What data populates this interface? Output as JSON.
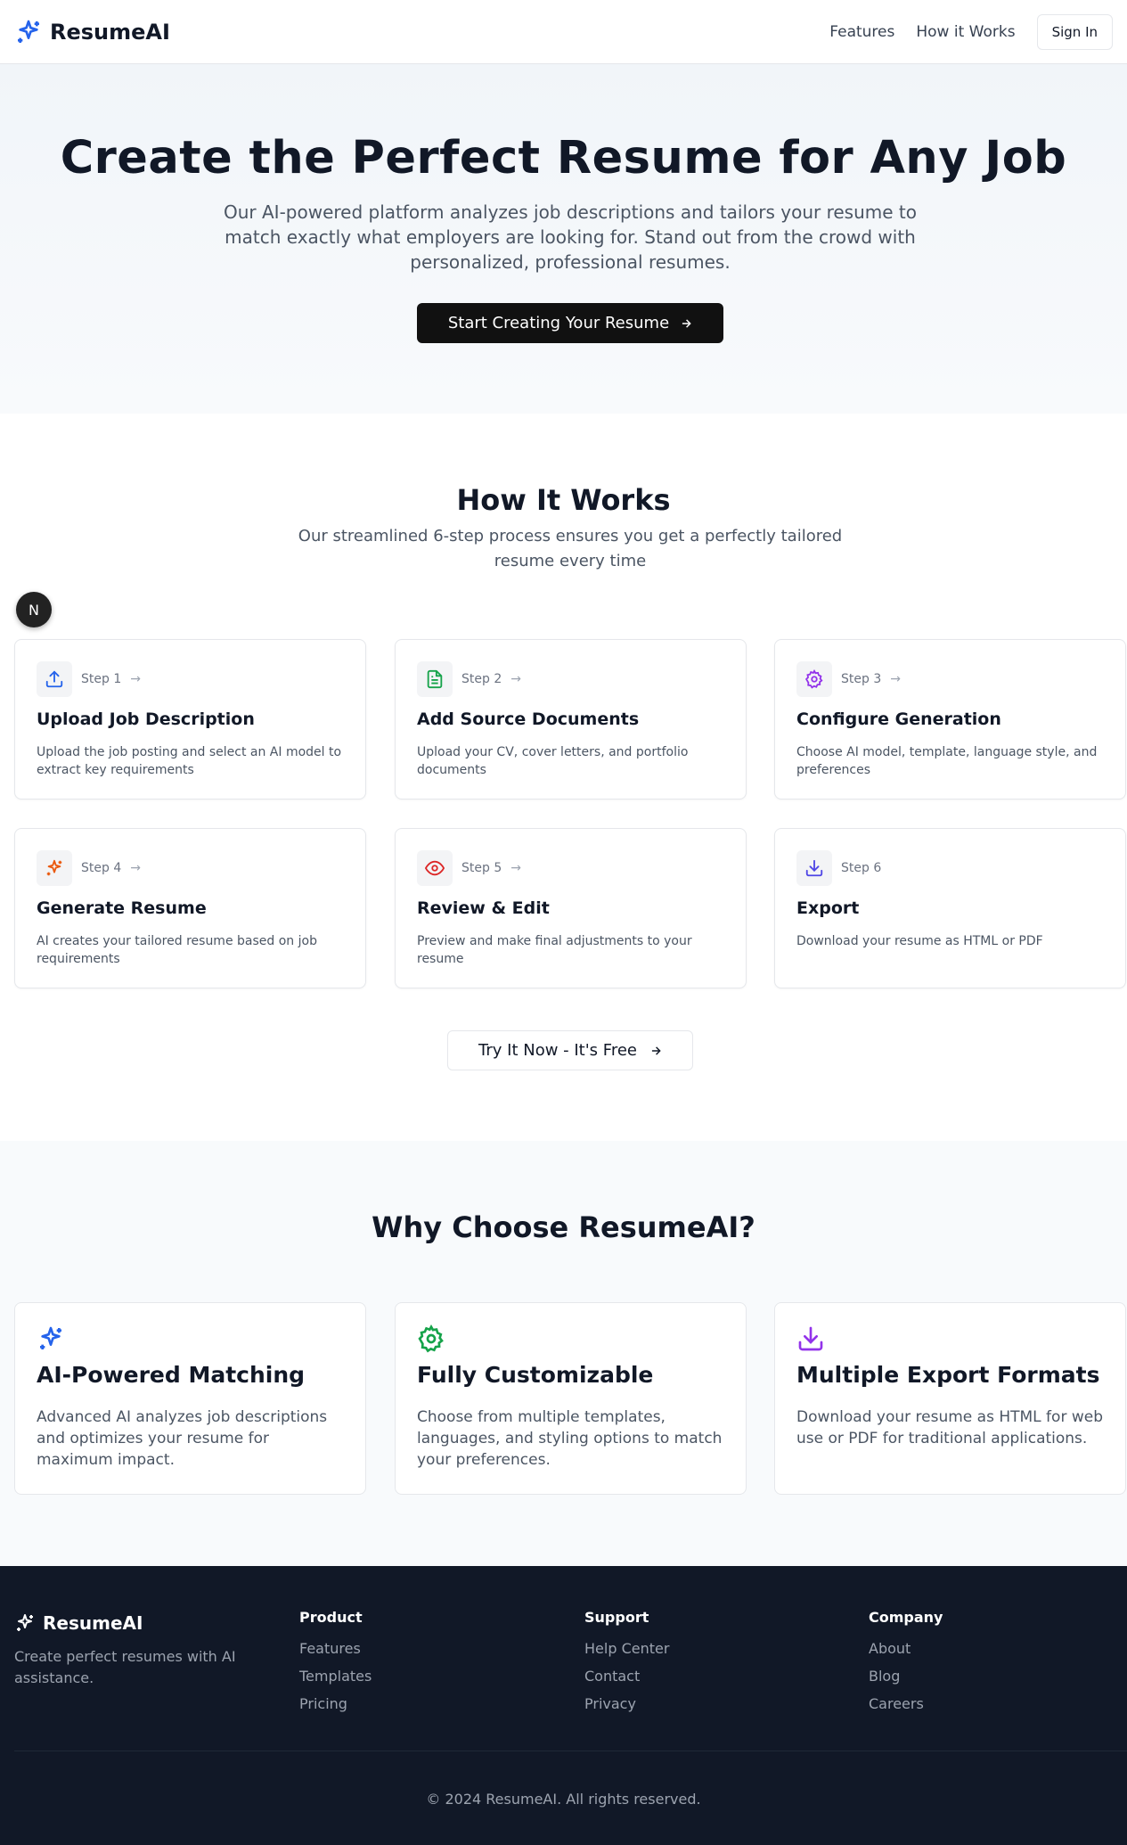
{
  "header": {
    "brand": "ResumeAI",
    "nav": [
      "Features",
      "How it Works"
    ],
    "signin": "Sign In"
  },
  "hero": {
    "title": "Create the Perfect Resume for Any Job",
    "subtitle": "Our AI-powered platform analyzes job descriptions and tailors your resume to match exactly what employers are looking for. Stand out from the crowd with personalized, professional resumes.",
    "cta": "Start Creating Your Resume",
    "cta_icon": "arrow-right-icon"
  },
  "how": {
    "title": "How It Works",
    "subtitle": "Our streamlined 6-step process ensures you get a perfectly tailored resume every time",
    "badge": "N",
    "steps": [
      {
        "label": "Step 1",
        "title": "Upload Job Description",
        "desc": "Upload the job posting and select an AI model to extract key requirements",
        "icon": "upload-icon",
        "color": "#2563eb"
      },
      {
        "label": "Step 2",
        "title": "Add Source Documents",
        "desc": "Upload your CV, cover letters, and portfolio documents",
        "icon": "file-text-icon",
        "color": "#16a34a"
      },
      {
        "label": "Step 3",
        "title": "Configure Generation",
        "desc": "Choose AI model, template, language style, and preferences",
        "icon": "settings-icon",
        "color": "#9333ea"
      },
      {
        "label": "Step 4",
        "title": "Generate Resume",
        "desc": "AI creates your tailored resume based on job requirements",
        "icon": "sparkles-icon",
        "color": "#ea580c"
      },
      {
        "label": "Step 5",
        "title": "Review & Edit",
        "desc": "Preview and make final adjustments to your resume",
        "icon": "eye-icon",
        "color": "#dc2626"
      },
      {
        "label": "Step 6",
        "title": "Export",
        "desc": "Download your resume as HTML or PDF",
        "icon": "download-icon",
        "color": "#4f46e5"
      }
    ],
    "cta": "Try It Now - It's Free"
  },
  "why": {
    "title": "Why Choose ResumeAI?",
    "features": [
      {
        "title": "AI-Powered Matching",
        "desc": "Advanced AI analyzes job descriptions and optimizes your resume for maximum impact.",
        "icon": "sparkles-icon",
        "color": "#2563eb"
      },
      {
        "title": "Fully Customizable",
        "desc": "Choose from multiple templates, languages, and styling options to match your preferences.",
        "icon": "settings-icon",
        "color": "#16a34a"
      },
      {
        "title": "Multiple Export Formats",
        "desc": "Download your resume as HTML for web use or PDF for traditional applications.",
        "icon": "download-icon",
        "color": "#9333ea"
      }
    ]
  },
  "footer": {
    "brand": "ResumeAI",
    "tagline": "Create perfect resumes with AI assistance.",
    "columns": [
      {
        "heading": "Product",
        "links": [
          "Features",
          "Templates",
          "Pricing"
        ]
      },
      {
        "heading": "Support",
        "links": [
          "Help Center",
          "Contact",
          "Privacy"
        ]
      },
      {
        "heading": "Company",
        "links": [
          "About",
          "Blog",
          "Careers"
        ]
      }
    ],
    "copyright": "© 2024 ResumeAI. All rights reserved."
  }
}
